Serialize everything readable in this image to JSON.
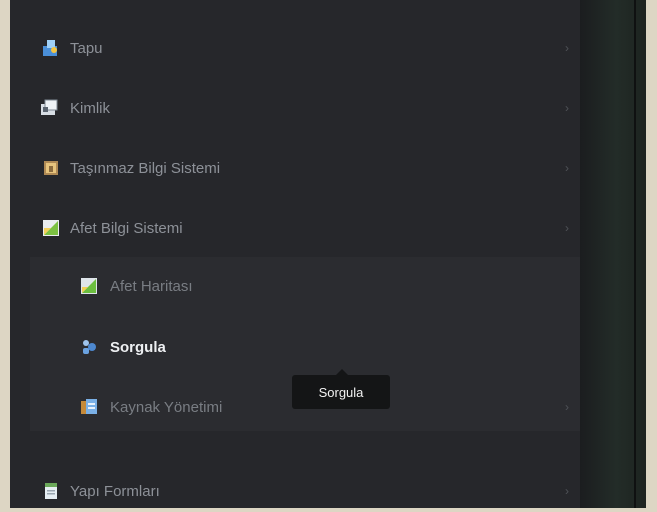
{
  "menu": {
    "items": [
      {
        "label": "Tapu",
        "icon": "tapu-icon"
      },
      {
        "label": "Kimlik",
        "icon": "kimlik-icon"
      },
      {
        "label": "Taşınmaz Bilgi Sistemi",
        "icon": "tasinmaz-icon"
      },
      {
        "label": "Afet Bilgi Sistemi",
        "icon": "afet-icon"
      }
    ],
    "submenu": [
      {
        "label": "Afet Haritası",
        "icon": "map-icon"
      },
      {
        "label": "Sorgula",
        "icon": "search-users-icon",
        "active": true
      },
      {
        "label": "Kaynak Yönetimi",
        "icon": "kaynak-icon"
      }
    ],
    "bottom_item": {
      "label": "Yapı Formları",
      "icon": "document-icon"
    },
    "arrow_glyph": "›"
  },
  "tooltip": {
    "text": "Sorgula"
  }
}
